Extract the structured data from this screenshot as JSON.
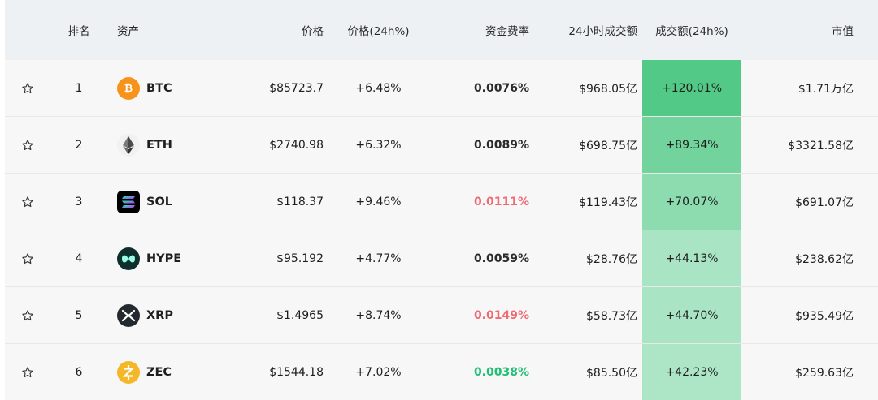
{
  "header": {
    "rank": "排名",
    "asset": "资产",
    "price": "价格",
    "price_change": "价格(24h%)",
    "funding_rate": "资金费率",
    "volume_24h": "24小时成交额",
    "volume_change": "成交额(24h%)",
    "market_cap": "市值"
  },
  "rows": [
    {
      "rank": "1",
      "symbol": "BTC",
      "icon": "bitcoin-icon",
      "price": "$85723.7",
      "change": "+6.48%",
      "funding": "0.0076%",
      "funding_color": "#2b2b2b",
      "volume": "$968.05亿",
      "volume_change": "+120.01%",
      "volume_change_bg": "#52c986",
      "market_cap": "$1.71万亿"
    },
    {
      "rank": "2",
      "symbol": "ETH",
      "icon": "ethereum-icon",
      "price": "$2740.98",
      "change": "+6.32%",
      "funding": "0.0089%",
      "funding_color": "#2b2b2b",
      "volume": "$698.75亿",
      "volume_change": "+89.34%",
      "volume_change_bg": "#72d49c",
      "market_cap": "$3321.58亿"
    },
    {
      "rank": "3",
      "symbol": "SOL",
      "icon": "solana-icon",
      "price": "$118.37",
      "change": "+9.46%",
      "funding": "0.0111%",
      "funding_color": "#ef6b73",
      "volume": "$119.43亿",
      "volume_change": "+70.07%",
      "volume_change_bg": "#8cdcb0",
      "market_cap": "$691.07亿"
    },
    {
      "rank": "4",
      "symbol": "HYPE",
      "icon": "hyperliquid-icon",
      "price": "$95.192",
      "change": "+4.77%",
      "funding": "0.0059%",
      "funding_color": "#2b2b2b",
      "volume": "$28.76亿",
      "volume_change": "+44.13%",
      "volume_change_bg": "#a9e5c4",
      "market_cap": "$238.62亿"
    },
    {
      "rank": "5",
      "symbol": "XRP",
      "icon": "xrp-icon",
      "price": "$1.4965",
      "change": "+8.74%",
      "funding": "0.0149%",
      "funding_color": "#ef6b73",
      "volume": "$58.73亿",
      "volume_change": "+44.70%",
      "volume_change_bg": "#a9e5c4",
      "market_cap": "$935.49亿"
    },
    {
      "rank": "6",
      "symbol": "ZEC",
      "icon": "zcash-icon",
      "price": "$1544.18",
      "change": "+7.02%",
      "funding": "0.0038%",
      "funding_color": "#1fbf75",
      "volume": "$85.50亿",
      "volume_change": "+42.23%",
      "volume_change_bg": "#acE6c6",
      "market_cap": "$259.63亿"
    }
  ]
}
